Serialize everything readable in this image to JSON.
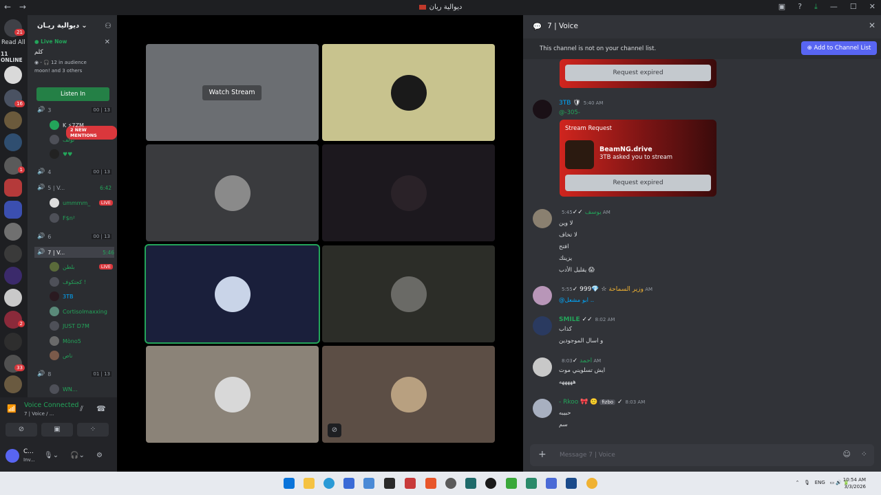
{
  "window": {
    "title": "ديوالية ريان",
    "nav": "← →"
  },
  "rail": {
    "badges": [
      "21",
      "16",
      "1",
      "2",
      "33"
    ],
    "read_all": "Read All",
    "online": "11 ONLINE"
  },
  "sidebar": {
    "server_name": "ديوالية ريـان",
    "live_card": {
      "status": "Live Now",
      "title": "كلم",
      "audience": "12 in audience",
      "attendees": "moon! and 3 others",
      "listen_label": "Listen In"
    },
    "mentions_label": "2 NEW MENTIONS",
    "voice_channels": [
      {
        "name": "3",
        "count": "00 | 13",
        "time": ""
      },
      {
        "name": "4",
        "count": "00 | 13",
        "time": ""
      },
      {
        "name": "5 | V...",
        "count": "",
        "time": "6:42"
      },
      {
        "name": "6",
        "count": "00 | 13",
        "time": ""
      },
      {
        "name": "7 | V...",
        "count": "",
        "time": "5:46"
      },
      {
        "name": "8",
        "count": "01 | 13",
        "time": ""
      }
    ],
    "members_ch3": [
      "K ⚡7ZM",
      "تولف",
      "♥♥"
    ],
    "members_ch5": [
      "ummmm_",
      "F$n²"
    ],
    "members_ch5_live": "LIVE",
    "members_ch7": [
      "بلطن",
      "كجتكوف !",
      "3TB",
      "Cortisolmaxxing",
      "JUST D7M",
      "Mòno5",
      "ناص"
    ],
    "members_ch7_live": "LIVE",
    "members_ch8": [
      "WN..."
    ]
  },
  "voice_panel": {
    "status": "Voice Connected",
    "sub": "7 | Voice / ...",
    "user_name": "C...",
    "user_sub": "Inv..."
  },
  "stage": {
    "watch_label": "Watch Stream",
    "tiles": [
      {
        "name": "stream-tile",
        "bg": "#6b6e72"
      },
      {
        "name": "colombia-tile",
        "bg": "#c8c38e"
      },
      {
        "name": "user-tile-3",
        "bg": "#3a3b3e"
      },
      {
        "name": "user-tile-4",
        "bg": "#1c181e"
      },
      {
        "name": "user-tile-5",
        "bg": "#1a1f3b"
      },
      {
        "name": "user-tile-6",
        "bg": "#2c2d28"
      },
      {
        "name": "user-tile-7",
        "bg": "#8b8378"
      },
      {
        "name": "user-tile-8",
        "bg": "#5c4e45"
      }
    ]
  },
  "chat": {
    "channel": "7 | Voice",
    "notice": "This channel is not on your channel list.",
    "add_label": "Add to Channel List",
    "expired_label": "Request expired",
    "messages": [
      {
        "author": "3TB",
        "time": "5:40 AM",
        "lines": [
          "@-305-"
        ],
        "color": "#dbdee1"
      },
      {
        "author": "يوسف",
        "time": "5:45 AM",
        "lines": [
          "لا وين",
          "لا تخاف",
          "افتح",
          "يزينك",
          "يقليل الأدب 😱"
        ],
        "color": "#23a55a"
      },
      {
        "author": "وزير السماحة",
        "time": "5:55 AM",
        "lines": [
          "@ابو مشعل .."
        ],
        "color": "#f0b232",
        "extra": "999"
      },
      {
        "author": "SMILE",
        "time": "8:02 AM",
        "lines": [
          "كذاب",
          "و اسال الموجودين"
        ],
        "color": "#23a55a"
      },
      {
        "author": "احمد",
        "time": "8:03 AM",
        "lines": [
          "ايش تسلويني موت",
          "هههههه"
        ],
        "color": "#23a55a"
      },
      {
        "author": "- Rkoo",
        "time": "8:03 AM",
        "lines": [
          "حبيبه",
          "سم"
        ],
        "color": "#23a55a",
        "extra": "fizbo"
      }
    ],
    "stream_request": {
      "label": "Stream Request",
      "game": "BeamNG.drive",
      "sub": "3TB asked you to stream"
    },
    "composer_placeholder": "Message 7 | Voice"
  },
  "taskbar": {
    "lang": "ENG",
    "time": "10:54 AM",
    "date": "3/3/2026"
  }
}
